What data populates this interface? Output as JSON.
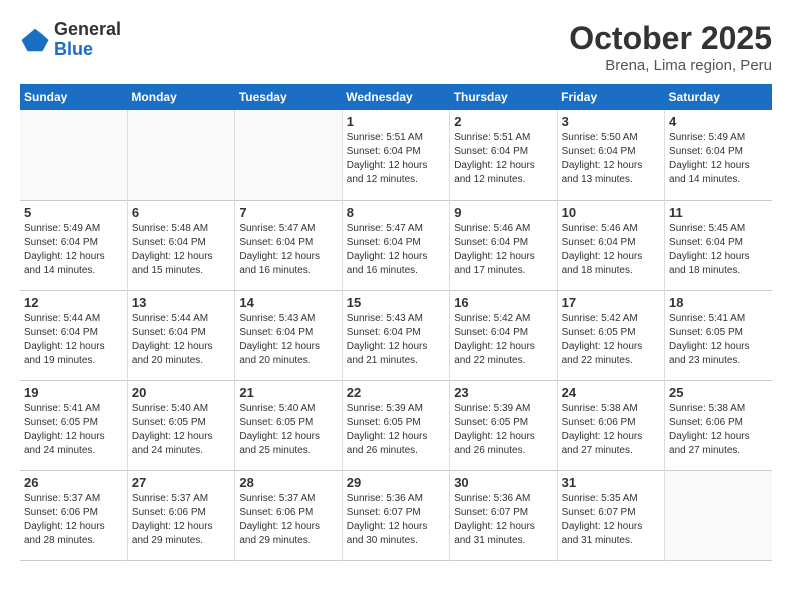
{
  "logo": {
    "line1": "General",
    "line2": "Blue"
  },
  "title": "October 2025",
  "location": "Brena, Lima region, Peru",
  "days_of_week": [
    "Sunday",
    "Monday",
    "Tuesday",
    "Wednesday",
    "Thursday",
    "Friday",
    "Saturday"
  ],
  "weeks": [
    [
      {
        "day": "",
        "info": ""
      },
      {
        "day": "",
        "info": ""
      },
      {
        "day": "",
        "info": ""
      },
      {
        "day": "1",
        "info": "Sunrise: 5:51 AM\nSunset: 6:04 PM\nDaylight: 12 hours\nand 12 minutes."
      },
      {
        "day": "2",
        "info": "Sunrise: 5:51 AM\nSunset: 6:04 PM\nDaylight: 12 hours\nand 12 minutes."
      },
      {
        "day": "3",
        "info": "Sunrise: 5:50 AM\nSunset: 6:04 PM\nDaylight: 12 hours\nand 13 minutes."
      },
      {
        "day": "4",
        "info": "Sunrise: 5:49 AM\nSunset: 6:04 PM\nDaylight: 12 hours\nand 14 minutes."
      }
    ],
    [
      {
        "day": "5",
        "info": "Sunrise: 5:49 AM\nSunset: 6:04 PM\nDaylight: 12 hours\nand 14 minutes."
      },
      {
        "day": "6",
        "info": "Sunrise: 5:48 AM\nSunset: 6:04 PM\nDaylight: 12 hours\nand 15 minutes."
      },
      {
        "day": "7",
        "info": "Sunrise: 5:47 AM\nSunset: 6:04 PM\nDaylight: 12 hours\nand 16 minutes."
      },
      {
        "day": "8",
        "info": "Sunrise: 5:47 AM\nSunset: 6:04 PM\nDaylight: 12 hours\nand 16 minutes."
      },
      {
        "day": "9",
        "info": "Sunrise: 5:46 AM\nSunset: 6:04 PM\nDaylight: 12 hours\nand 17 minutes."
      },
      {
        "day": "10",
        "info": "Sunrise: 5:46 AM\nSunset: 6:04 PM\nDaylight: 12 hours\nand 18 minutes."
      },
      {
        "day": "11",
        "info": "Sunrise: 5:45 AM\nSunset: 6:04 PM\nDaylight: 12 hours\nand 18 minutes."
      }
    ],
    [
      {
        "day": "12",
        "info": "Sunrise: 5:44 AM\nSunset: 6:04 PM\nDaylight: 12 hours\nand 19 minutes."
      },
      {
        "day": "13",
        "info": "Sunrise: 5:44 AM\nSunset: 6:04 PM\nDaylight: 12 hours\nand 20 minutes."
      },
      {
        "day": "14",
        "info": "Sunrise: 5:43 AM\nSunset: 6:04 PM\nDaylight: 12 hours\nand 20 minutes."
      },
      {
        "day": "15",
        "info": "Sunrise: 5:43 AM\nSunset: 6:04 PM\nDaylight: 12 hours\nand 21 minutes."
      },
      {
        "day": "16",
        "info": "Sunrise: 5:42 AM\nSunset: 6:04 PM\nDaylight: 12 hours\nand 22 minutes."
      },
      {
        "day": "17",
        "info": "Sunrise: 5:42 AM\nSunset: 6:05 PM\nDaylight: 12 hours\nand 22 minutes."
      },
      {
        "day": "18",
        "info": "Sunrise: 5:41 AM\nSunset: 6:05 PM\nDaylight: 12 hours\nand 23 minutes."
      }
    ],
    [
      {
        "day": "19",
        "info": "Sunrise: 5:41 AM\nSunset: 6:05 PM\nDaylight: 12 hours\nand 24 minutes."
      },
      {
        "day": "20",
        "info": "Sunrise: 5:40 AM\nSunset: 6:05 PM\nDaylight: 12 hours\nand 24 minutes."
      },
      {
        "day": "21",
        "info": "Sunrise: 5:40 AM\nSunset: 6:05 PM\nDaylight: 12 hours\nand 25 minutes."
      },
      {
        "day": "22",
        "info": "Sunrise: 5:39 AM\nSunset: 6:05 PM\nDaylight: 12 hours\nand 26 minutes."
      },
      {
        "day": "23",
        "info": "Sunrise: 5:39 AM\nSunset: 6:05 PM\nDaylight: 12 hours\nand 26 minutes."
      },
      {
        "day": "24",
        "info": "Sunrise: 5:38 AM\nSunset: 6:06 PM\nDaylight: 12 hours\nand 27 minutes."
      },
      {
        "day": "25",
        "info": "Sunrise: 5:38 AM\nSunset: 6:06 PM\nDaylight: 12 hours\nand 27 minutes."
      }
    ],
    [
      {
        "day": "26",
        "info": "Sunrise: 5:37 AM\nSunset: 6:06 PM\nDaylight: 12 hours\nand 28 minutes."
      },
      {
        "day": "27",
        "info": "Sunrise: 5:37 AM\nSunset: 6:06 PM\nDaylight: 12 hours\nand 29 minutes."
      },
      {
        "day": "28",
        "info": "Sunrise: 5:37 AM\nSunset: 6:06 PM\nDaylight: 12 hours\nand 29 minutes."
      },
      {
        "day": "29",
        "info": "Sunrise: 5:36 AM\nSunset: 6:07 PM\nDaylight: 12 hours\nand 30 minutes."
      },
      {
        "day": "30",
        "info": "Sunrise: 5:36 AM\nSunset: 6:07 PM\nDaylight: 12 hours\nand 31 minutes."
      },
      {
        "day": "31",
        "info": "Sunrise: 5:35 AM\nSunset: 6:07 PM\nDaylight: 12 hours\nand 31 minutes."
      },
      {
        "day": "",
        "info": ""
      }
    ]
  ]
}
